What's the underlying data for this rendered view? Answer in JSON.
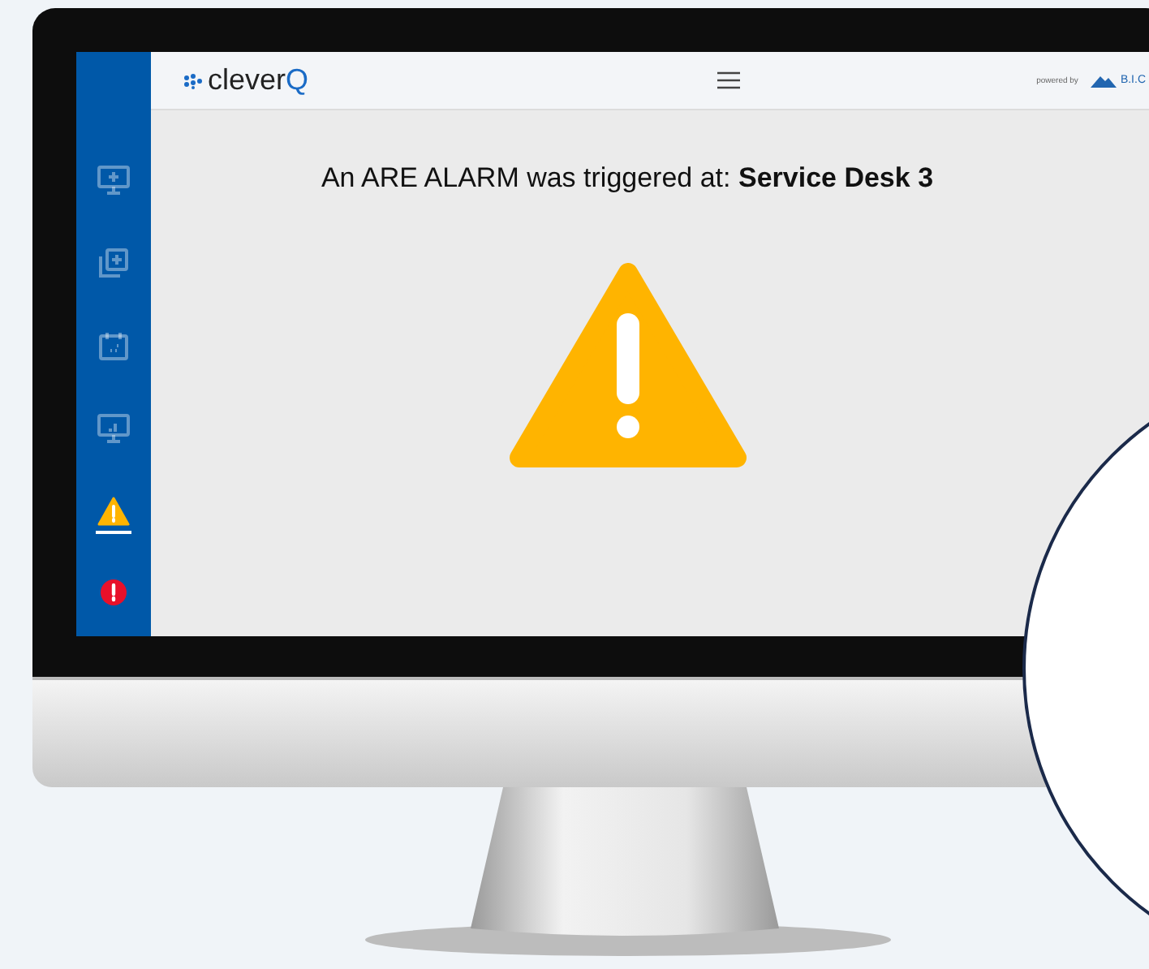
{
  "header": {
    "logo": "cleverQ",
    "powered_by": "powered by",
    "partner_logo": "B.I.C"
  },
  "sidebar": {
    "items": [
      {
        "kind": "screen-add",
        "selected": false
      },
      {
        "kind": "copy-add",
        "selected": false
      },
      {
        "kind": "calendar",
        "selected": false
      },
      {
        "kind": "screen-chart",
        "selected": false
      },
      {
        "kind": "warning",
        "selected": true
      },
      {
        "kind": "error",
        "selected": false
      }
    ]
  },
  "alarm": {
    "message": "An ARE ALARM was triggered at: **Service Desk 3**"
  }
}
